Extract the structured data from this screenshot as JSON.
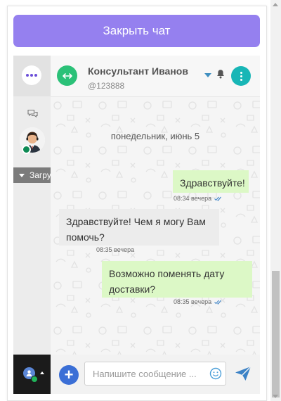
{
  "header": {
    "close_label": "Закрыть чат"
  },
  "sidebar": {
    "tooltip": "Загрузить"
  },
  "contact": {
    "name": "Консультант Иванов",
    "id": "@123888"
  },
  "messages": {
    "date": "понедельник, июнь 5",
    "items": [
      {
        "text": "Здравствуйте!",
        "time": "08:34 вечера",
        "direction": "outgoing",
        "read": true
      },
      {
        "text": "Здравствуйте! Чем я могу Вам помочь?",
        "time": "08:35 вечера",
        "direction": "incoming"
      },
      {
        "text": "Возможно поменять дату доставки?",
        "time": "08:35 вечера",
        "direction": "outgoing",
        "read": true
      }
    ]
  },
  "composer": {
    "placeholder": "Напишите сообщение ..."
  },
  "colors": {
    "accent": "#9580ef",
    "outgoing_bubble": "#dcf8c6",
    "incoming_bubble": "#ececec",
    "kebab": "#18b6b6",
    "add_button": "#3b6fd6",
    "send": "#3b82c6"
  },
  "icons": [
    "menu-dots-icon",
    "chat-bubbles-icon",
    "chevron-down-icon",
    "swap-arrows-icon",
    "bell-icon",
    "more-vertical-icon",
    "check-double-icon",
    "user-icon",
    "plus-icon",
    "emoji-icon",
    "send-icon"
  ]
}
